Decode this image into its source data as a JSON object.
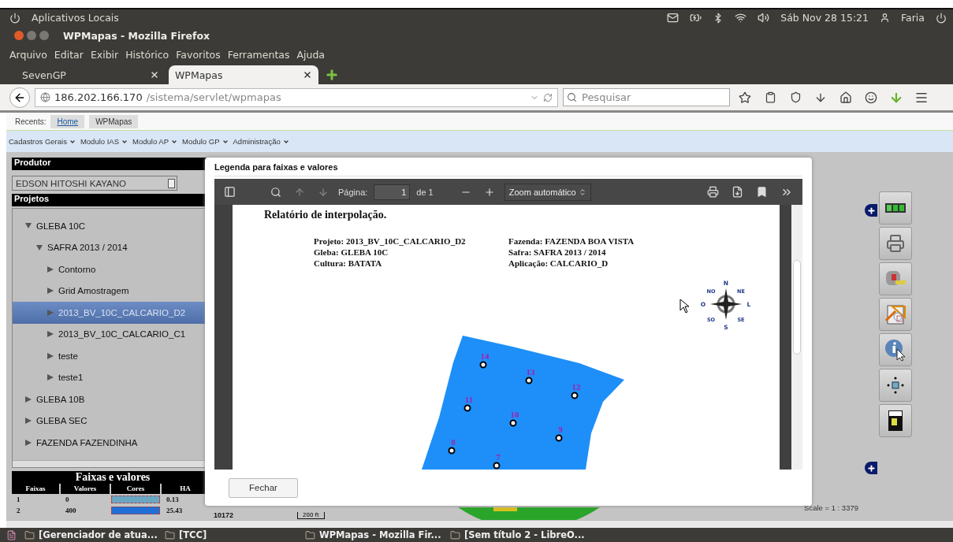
{
  "top_panel": {
    "title": "Aplicativos Locais",
    "clock": "Sáb Nov 28 15:21",
    "user": "Faria"
  },
  "window": {
    "title": "WPMapas - Mozilla Firefox"
  },
  "menu": [
    "Arquivo",
    "Editar",
    "Exibir",
    "Histórico",
    "Favoritos",
    "Ferramentas",
    "Ajuda"
  ],
  "tabs": [
    {
      "label": "SevenGP",
      "selected": false
    },
    {
      "label": "WPMapas",
      "selected": true
    }
  ],
  "address": {
    "host": "186.202.166.170",
    "path": "/sistema/servlet/wpmapas"
  },
  "search": {
    "placeholder": "Pesquisar"
  },
  "recents": {
    "label": "Recents:",
    "links": [
      {
        "label": "Home",
        "selected": true
      },
      {
        "label": "WPMapas",
        "selected": false
      }
    ]
  },
  "nav_menu": [
    "Cadastros Gerais",
    "Modulo IAS",
    "Modulo AP",
    "Modulo GP",
    "Administração"
  ],
  "producer": {
    "header": "Produtor",
    "value": "EDSON HITOSHI KAYANO"
  },
  "projects": {
    "header": "Projetos",
    "tree": [
      {
        "label": "GLEBA 10C",
        "expanded": true,
        "selected": false,
        "children": [
          {
            "label": "SAFRA 2013 / 2014",
            "expanded": true,
            "selected": false,
            "children": [
              {
                "label": "Contorno",
                "expanded": false,
                "selected": false
              },
              {
                "label": "Grid Amostragem",
                "expanded": false,
                "selected": false
              },
              {
                "label": "2013_BV_10C_CALCARIO_D2",
                "expanded": false,
                "selected": true
              },
              {
                "label": "2013_BV_10C_CALCARIO_C1",
                "expanded": false,
                "selected": false
              },
              {
                "label": "teste",
                "expanded": false,
                "selected": false
              },
              {
                "label": "teste1",
                "expanded": false,
                "selected": false
              }
            ]
          }
        ]
      },
      {
        "label": "GLEBA 10B",
        "expanded": false,
        "selected": false
      },
      {
        "label": "GLEBA SEC",
        "expanded": false,
        "selected": false
      },
      {
        "label": "FAZENDA FAZENDINHA",
        "expanded": false,
        "selected": false
      }
    ]
  },
  "legend": {
    "title": "Faixas e valores",
    "columns": [
      "Faixas",
      "Valores",
      "Cores",
      "HA"
    ],
    "rows": [
      {
        "band": "1",
        "value": "0",
        "color": "#6aa6c2",
        "ha": "0.13"
      },
      {
        "band": "2",
        "value": "400",
        "color": "#1f6fd6",
        "ha": "25.43"
      }
    ]
  },
  "map": {
    "area": "10172",
    "scale_bar": "200 ft",
    "scale": "Scale = 1 : 3379"
  },
  "dialog": {
    "title": "Legenda para faixas e valores",
    "viewer": {
      "page_label": "Página:",
      "page": "1",
      "page_count": "de 1",
      "zoom": "Zoom automático"
    },
    "report": {
      "heading": "Relatório de interpolação.",
      "left": [
        "Projeto: 2013_BV_10C_CALCARIO_D2",
        "Gleba: GLEBA 10C",
        "Cultura: BATATA"
      ],
      "right": [
        "Fazenda: FAZENDA BOA VISTA",
        "Safra: SAFRA 2013 / 2014",
        "Aplicação: CALCARIO_D"
      ],
      "compass": [
        "N",
        "NE",
        "L",
        "SE",
        "S",
        "SO",
        "O",
        "NO"
      ],
      "points": [
        "14",
        "13",
        "12",
        "11",
        "10",
        "9",
        "8",
        "7"
      ]
    },
    "close": "Fechar"
  },
  "taskbar": [
    "[Gerenciador de atua...",
    "[TCC]",
    "WPMapas - Mozilla Fir...",
    "[Sem título 2 - LibreO..."
  ]
}
